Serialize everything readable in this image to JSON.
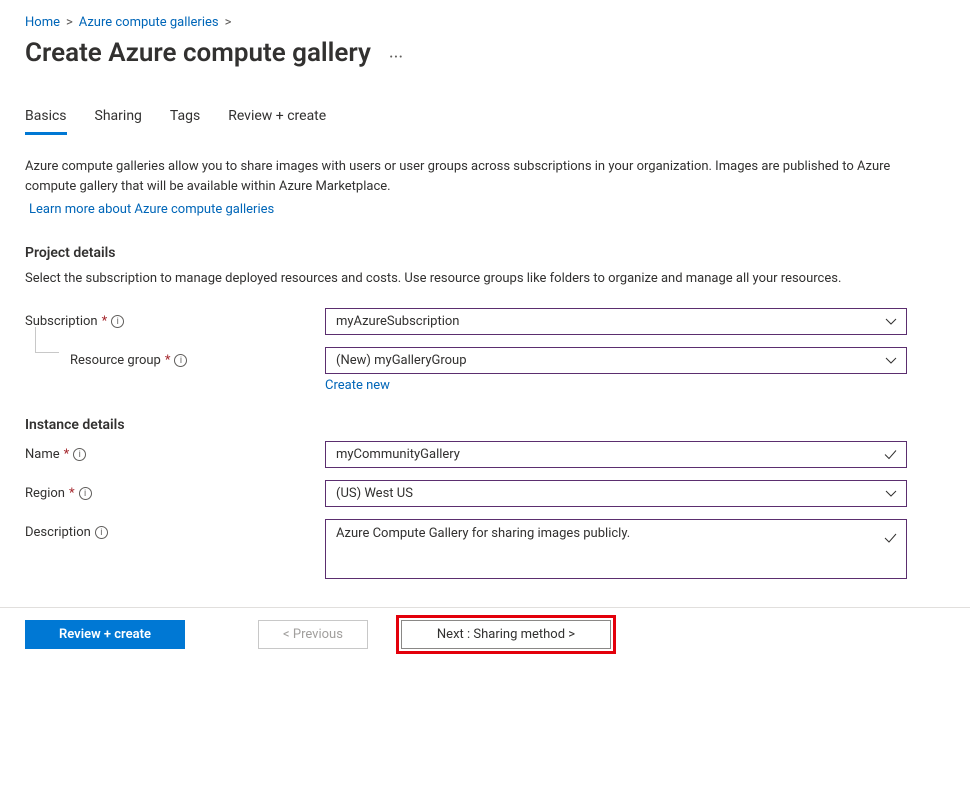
{
  "breadcrumb": {
    "home": "Home",
    "galleries": "Azure compute galleries"
  },
  "title": "Create Azure compute gallery",
  "more_icon": "···",
  "tabs": {
    "basics": "Basics",
    "sharing": "Sharing",
    "tags": "Tags",
    "review": "Review + create"
  },
  "intro": {
    "text": "Azure compute galleries allow you to share images with users or user groups across subscriptions in your organization. Images are published to Azure compute gallery that will be available within Azure Marketplace.",
    "link": "Learn more about Azure compute galleries"
  },
  "project_details": {
    "title": "Project details",
    "desc": "Select the subscription to manage deployed resources and costs. Use resource groups like folders to organize and manage all your resources.",
    "subscription_label": "Subscription",
    "subscription_value": "myAzureSubscription",
    "resource_group_label": "Resource group",
    "resource_group_value": "(New) myGalleryGroup",
    "create_new": "Create new"
  },
  "instance_details": {
    "title": "Instance details",
    "name_label": "Name",
    "name_value": "myCommunityGallery",
    "region_label": "Region",
    "region_value": "(US) West US",
    "description_label": "Description",
    "description_value": "Azure Compute Gallery for sharing images publicly."
  },
  "footer": {
    "review": "Review + create",
    "previous": "< Previous",
    "next": "Next : Sharing method >"
  }
}
